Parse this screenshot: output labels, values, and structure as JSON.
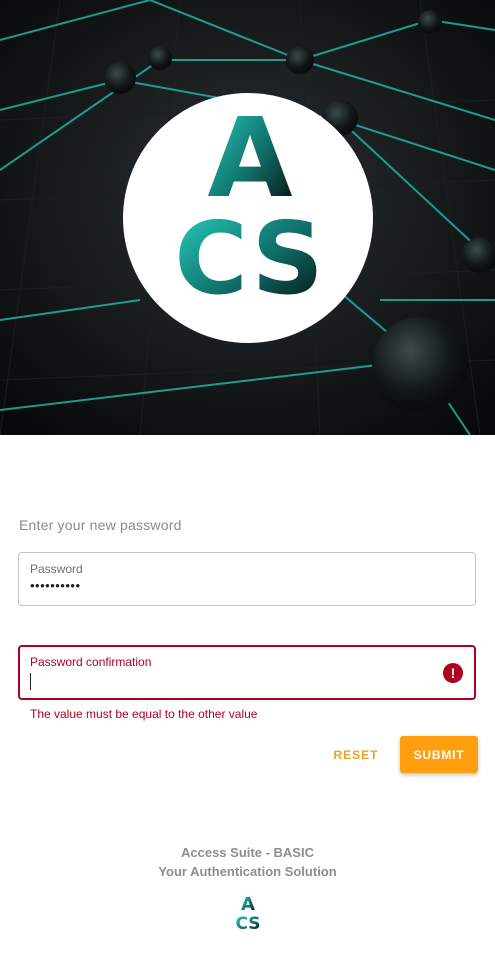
{
  "hero": {
    "logo_letters_top": "A",
    "logo_letters_bottom": "CS"
  },
  "form": {
    "title": "Enter your new password",
    "password": {
      "label": "Password",
      "value": "••••••••••"
    },
    "confirmation": {
      "label": "Password confirmation",
      "value": "",
      "error_icon": "!",
      "error_message": "The value must be equal to the other value"
    },
    "reset_label": "RESET",
    "submit_label": "SUBMIT"
  },
  "footer": {
    "line1": "Access Suite - BASIC",
    "line2": "Your Authentication Solution"
  },
  "colors": {
    "accent": "#ff9f10",
    "error": "#b00020",
    "teal": "#1fb3a8"
  },
  "icons": {
    "error": "error-circle-icon"
  }
}
